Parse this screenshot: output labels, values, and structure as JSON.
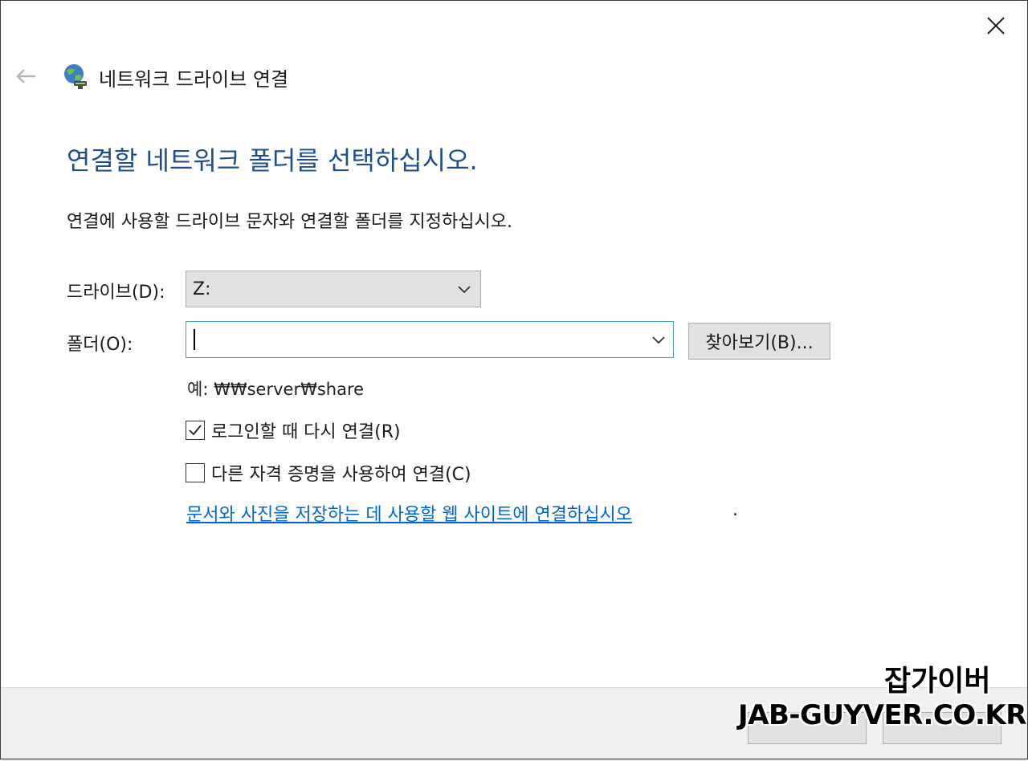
{
  "window": {
    "title": "네트워크 드라이브 연결",
    "accent_color": "#1e4f8c",
    "link_color": "#0066cc"
  },
  "nav": {
    "back_icon": "arrow-left-icon",
    "close_icon": "close-icon"
  },
  "main": {
    "heading": "연결할 네트워크 폴더를 선택하십시오.",
    "instruction": "연결에 사용할 드라이브 문자와 연결할 폴더를 지정하십시오.",
    "drive": {
      "label": "드라이브(D):",
      "value": "Z:"
    },
    "folder": {
      "label": "폴더(O):",
      "value": "",
      "browse_label": "찾아보기(B)..."
    },
    "example": "예: ₩₩server₩share",
    "reconnect": {
      "label": "로그인할 때 다시 연결(R)",
      "checked": true
    },
    "credentials": {
      "label": "다른 자격 증명을 사용하여 연결(C)",
      "checked": false
    },
    "web_link": "문서와 사진을 저장하는 데 사용할 웹 사이트에 연결하십시오",
    "web_link_suffix": "."
  },
  "watermark": {
    "korean": "잡가이버",
    "english": "JAB-GUYVER.CO.KR"
  }
}
